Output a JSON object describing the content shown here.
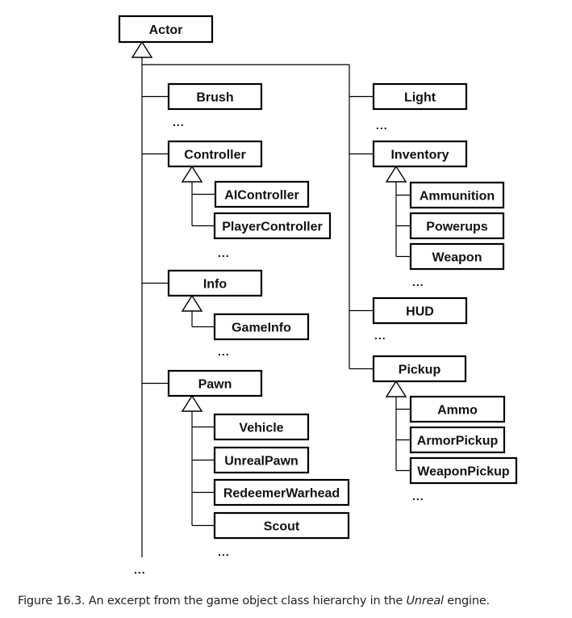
{
  "diagram": {
    "type": "uml-class-hierarchy",
    "root": "Actor",
    "ellipsis": "...",
    "classes": {
      "actor": "Actor",
      "brush": "Brush",
      "controller": "Controller",
      "aicontroller": "AIController",
      "playercontroller": "PlayerController",
      "info": "Info",
      "gameinfo": "GameInfo",
      "pawn": "Pawn",
      "vehicle": "Vehicle",
      "unrealpawn": "UnrealPawn",
      "redeemerwarhead": "RedeemerWarhead",
      "scout": "Scout",
      "light": "Light",
      "inventory": "Inventory",
      "ammunition": "Ammunition",
      "powerups": "Powerups",
      "weapon": "Weapon",
      "hud": "HUD",
      "pickup": "Pickup",
      "ammo": "Ammo",
      "armorpickup": "ArmorPickup",
      "weaponpickup": "WeaponPickup"
    },
    "hierarchy": {
      "Actor": [
        "Brush",
        "Controller",
        "Info",
        "Pawn",
        "Light",
        "Inventory",
        "HUD",
        "Pickup"
      ],
      "Controller": [
        "AIController",
        "PlayerController"
      ],
      "Info": [
        "GameInfo"
      ],
      "Pawn": [
        "Vehicle",
        "UnrealPawn",
        "RedeemerWarhead",
        "Scout"
      ],
      "Inventory": [
        "Ammunition",
        "Powerups",
        "Weapon"
      ],
      "Pickup": [
        "Ammo",
        "ArmorPickup",
        "WeaponPickup"
      ]
    }
  },
  "caption": {
    "prefix": "Figure 16.3. An excerpt from the game object class hierarchy in the ",
    "emphasis": "Unreal",
    "suffix": " engine."
  }
}
